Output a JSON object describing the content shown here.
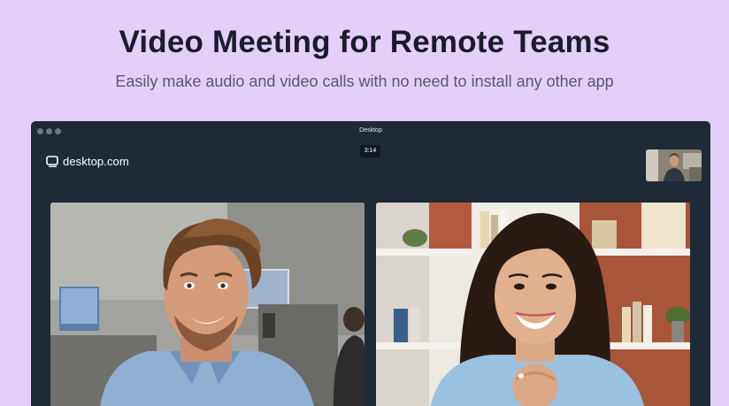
{
  "hero": {
    "title": "Video Meeting for Remote Teams",
    "subtitle": "Easily make audio and video calls with no need to install any other app"
  },
  "app_window": {
    "title": "Desktop",
    "logo_text": "desktop.com",
    "call_timer": "3:14"
  },
  "participants": [
    {
      "name": "participant-man-video"
    },
    {
      "name": "participant-woman-video"
    }
  ],
  "icons": [
    "window-control-dots",
    "desktop-logo-icon"
  ],
  "colors": {
    "page_background": "#e4cffb",
    "window_background": "#1f2a37",
    "headline": "#1a1c2c",
    "subline": "#575a70"
  }
}
